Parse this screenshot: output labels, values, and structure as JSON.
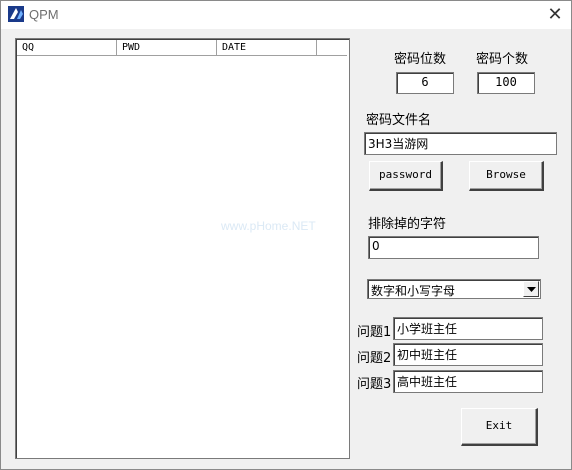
{
  "window": {
    "title": "QPM",
    "icon": "qpm-app-icon",
    "close_icon": "close-icon"
  },
  "list": {
    "columns": [
      "QQ",
      "PWD",
      "DATE",
      ""
    ],
    "rows": []
  },
  "settings": {
    "pwd_length_label": "密码位数",
    "pwd_length_value": "6",
    "pwd_count_label": "密码个数",
    "pwd_count_value": "100",
    "filename_label": "密码文件名",
    "filename_value": "3H3当游网",
    "password_button": "password",
    "browse_button": "Browse",
    "exclude_label": "排除掉的字符",
    "exclude_value": "0",
    "charset_selected": "数字和小写字母"
  },
  "questions": [
    {
      "label": "问题1",
      "value": "小学班主任"
    },
    {
      "label": "问题2",
      "value": "初中班主任"
    },
    {
      "label": "问题3",
      "value": "高中班主任"
    }
  ],
  "exit_button": "Exit",
  "watermark": "www.pHome.NET"
}
